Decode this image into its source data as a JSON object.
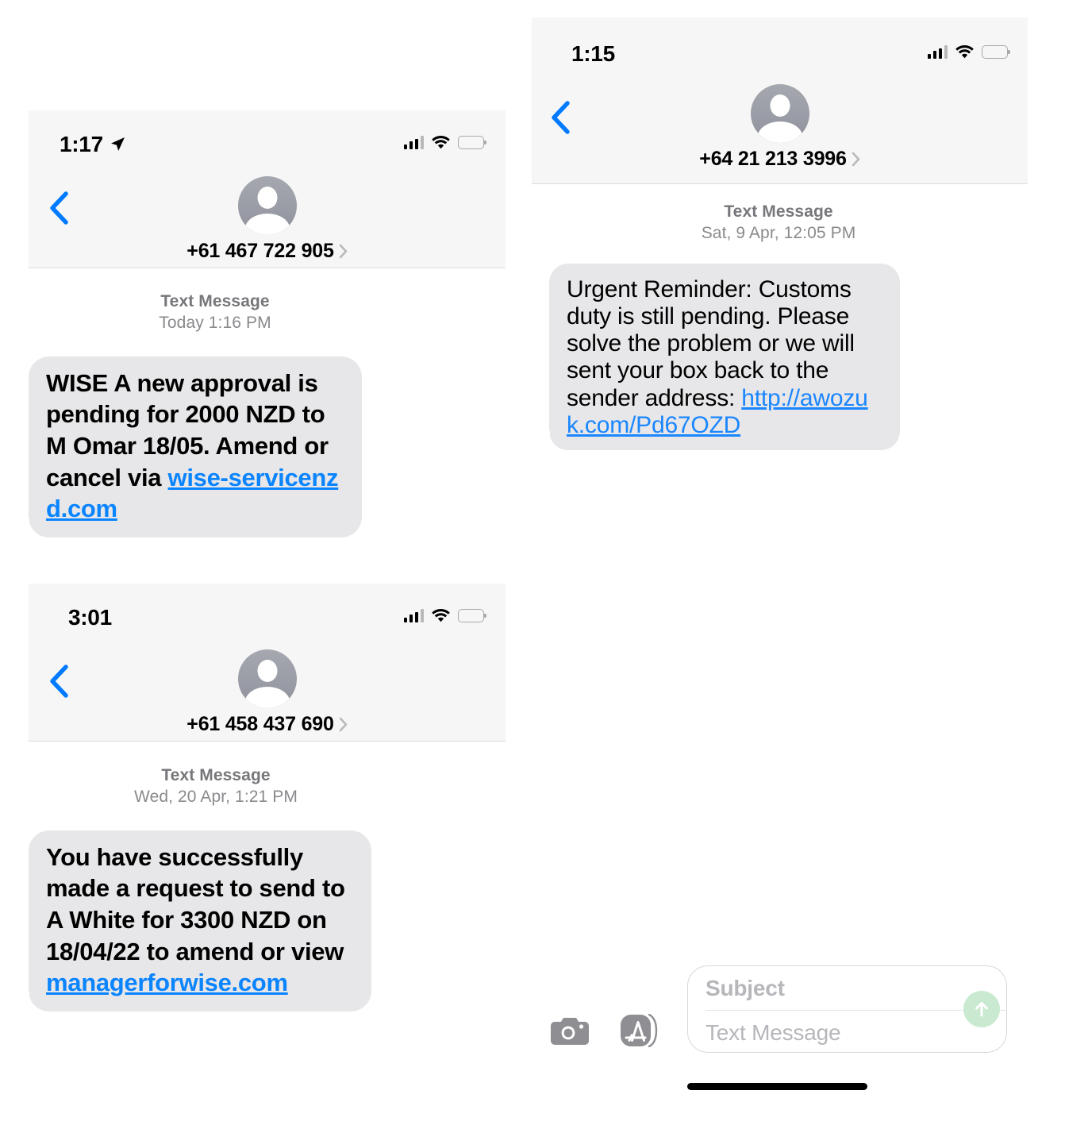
{
  "conversations": [
    {
      "id": "convo-1",
      "status_bar": {
        "time": "1:17",
        "location_arrow": true,
        "signal": "4-bars",
        "wifi": "wifi-icon",
        "battery": "battery-icon"
      },
      "back_label": "back-chevron",
      "contact": {
        "avatar": "contact-avatar",
        "number": "+61 467 722 905",
        "detail_chevron": "chevron-right-icon"
      },
      "meta": {
        "type": "Text Message",
        "date": "Today 1:16 PM"
      },
      "message": {
        "segments": [
          {
            "text": "WISE A new approval is pending for 2000 NZD to M Omar 18/05. Amend or cancel via ",
            "kind": "text"
          },
          {
            "text": "wise-servicenzd.com",
            "kind": "link"
          }
        ]
      }
    },
    {
      "id": "convo-2",
      "status_bar": {
        "time": "1:15",
        "location_arrow": false,
        "signal": "4-bars",
        "wifi": "wifi-icon",
        "battery": "battery-icon"
      },
      "back_label": "back-chevron",
      "contact": {
        "avatar": "contact-avatar",
        "number": "+64 21 213 3996",
        "detail_chevron": "chevron-right-icon"
      },
      "meta": {
        "type": "Text Message",
        "date": "Sat, 9 Apr, 12:05 PM"
      },
      "message": {
        "segments": [
          {
            "text": "Urgent Reminder: Customs duty is still pending. Please solve the problem or we will sent your box back to the sender address: ",
            "kind": "text"
          },
          {
            "text": "http://awozuk.com/Pd67OZD",
            "kind": "link"
          }
        ]
      }
    },
    {
      "id": "convo-3",
      "status_bar": {
        "time": "3:01",
        "location_arrow": false,
        "signal": "4-bars",
        "wifi": "wifi-icon",
        "battery": "battery-icon"
      },
      "back_label": "back-chevron",
      "contact": {
        "avatar": "contact-avatar",
        "number": "+61 458 437 690",
        "detail_chevron": "chevron-right-icon"
      },
      "meta": {
        "type": "Text Message",
        "date": "Wed, 20 Apr, 1:21 PM"
      },
      "message": {
        "segments": [
          {
            "text": "You have successfully made a request to send to A White for 3300 NZD on 18/04/22 to amend or view ",
            "kind": "text"
          },
          {
            "text": "managerforwise.com",
            "kind": "link"
          }
        ]
      }
    }
  ],
  "composer": {
    "camera_icon": "camera-icon",
    "appstore_icon": "app-store-icon",
    "subject_placeholder": "Subject",
    "message_placeholder": "Text Message",
    "send_icon": "send-arrow-up-icon",
    "send_color": "#c9ead0",
    "home_indicator": "home-indicator"
  },
  "colors": {
    "bubble_gray": "#e7e7e9",
    "link_blue": "#0a84ff",
    "header_gray": "#f6f6f6",
    "meta_gray": "#8a8a8e",
    "accent_blue": "#007aff"
  }
}
